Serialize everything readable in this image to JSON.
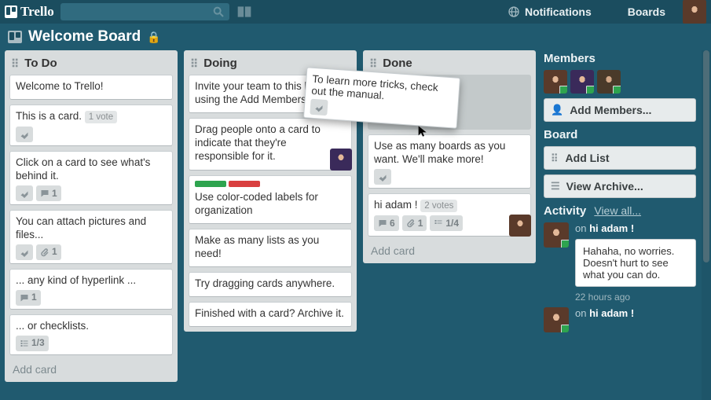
{
  "header": {
    "logo_text": "Trello",
    "notifications_label": "Notifications",
    "boards_label": "Boards",
    "search_placeholder": "Search"
  },
  "board": {
    "title": "Welcome Board",
    "is_private": true
  },
  "lists": [
    {
      "name": "To Do",
      "cards": [
        {
          "text": "Welcome to Trello!",
          "badges": []
        },
        {
          "text": "This is a card.",
          "votes": 1,
          "votes_label": "1 vote",
          "has_desc": true
        },
        {
          "text": "Click on a card to see what's behind it.",
          "has_desc": true,
          "comments": 1
        },
        {
          "text": "You can attach pictures and files...",
          "has_desc": true,
          "attachments": 1
        },
        {
          "text": "... any kind of hyperlink ...",
          "comments": 1
        },
        {
          "text": "... or checklists.",
          "checklist": "1/3"
        }
      ],
      "add_card_label": "Add card"
    },
    {
      "name": "Doing",
      "cards": [
        {
          "text": "Invite your team to this board using the Add Members button"
        },
        {
          "text": "Drag people onto a card to indicate that they're responsible for it.",
          "member": true
        },
        {
          "text": "Use color-coded labels for organization",
          "labels": [
            "#2ea44f",
            "#d93f3f"
          ]
        },
        {
          "text": "Make as many lists as you need!"
        },
        {
          "text": "Try dragging cards anywhere."
        },
        {
          "text": "Finished with a card? Archive it."
        }
      ],
      "add_card_label": "Add card"
    },
    {
      "name": "Done",
      "dragging_card": {
        "text": "To learn more tricks, check out the manual.",
        "has_desc": true
      },
      "cards": [
        {
          "placeholder": true,
          "height": 70
        },
        {
          "text": "Use as many boards as you want. We'll make more!",
          "has_desc": true
        },
        {
          "text": "hi adam !",
          "votes_label": "2 votes",
          "comments": 6,
          "attachments": 1,
          "checklist": "1/4",
          "member": true
        }
      ],
      "add_card_label": "Add card"
    }
  ],
  "sidebar": {
    "members_heading": "Members",
    "add_members_label": "Add Members...",
    "board_heading": "Board",
    "add_list_label": "Add List",
    "view_archive_label": "View Archive...",
    "activity_heading": "Activity",
    "view_all_label": "View all...",
    "activity": [
      {
        "action_prefix": "on",
        "card_ref": "hi adam !",
        "comment": "Hahaha, no worries. Doesn't hurt to see what you can do.",
        "time": "22 hours ago"
      },
      {
        "action_prefix": "on",
        "card_ref": "hi adam !"
      }
    ]
  },
  "colors": {
    "header_bg": "#1b4d5f",
    "canvas_bg": "#205a6f",
    "list_bg": "#d8dcdd"
  }
}
